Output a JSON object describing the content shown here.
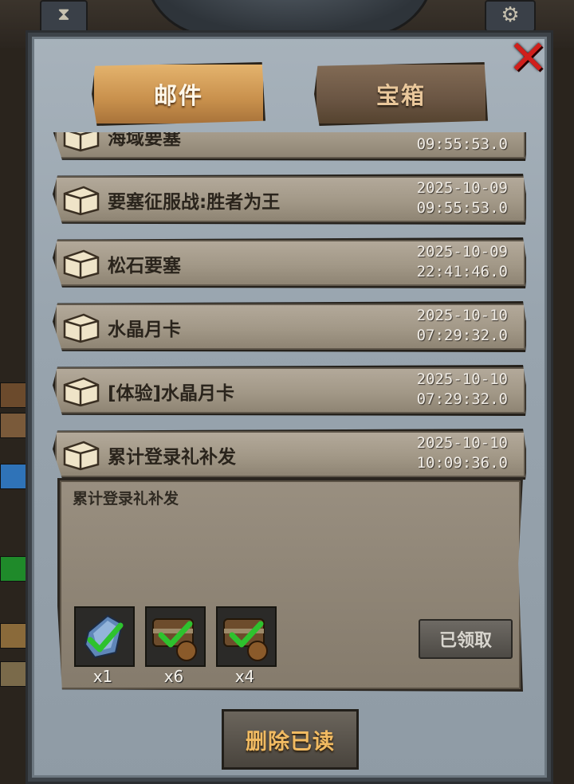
{
  "tabs": {
    "mail": "邮件",
    "chest": "宝箱"
  },
  "mails": [
    {
      "title": "海域要塞",
      "date": "",
      "time": "09:55:53.0"
    },
    {
      "title": "要塞征服战:胜者为王",
      "date": "2025-10-09",
      "time": "09:55:53.0"
    },
    {
      "title": "松石要塞",
      "date": "2025-10-09",
      "time": "22:41:46.0"
    },
    {
      "title": "水晶月卡",
      "date": "2025-10-10",
      "time": "07:29:32.0"
    },
    {
      "title": "[体验]水晶月卡",
      "date": "2025-10-10",
      "time": "07:29:32.0"
    },
    {
      "title": "累计登录礼补发",
      "date": "2025-10-10",
      "time": "10:09:36.0"
    }
  ],
  "detail": {
    "text": "累计登录礼补发",
    "rewards": [
      {
        "icon": "crystal-icon",
        "count": "x1"
      },
      {
        "icon": "chest-icon",
        "count": "x6"
      },
      {
        "icon": "chest-icon",
        "count": "x4"
      }
    ],
    "claimed_label": "已领取"
  },
  "delete_label": "删除已读",
  "colors": {
    "panel": "#98a4ae",
    "tab_active": "#c8904c",
    "tab_inactive": "#6a5543",
    "close": "#d11f1b",
    "check": "#2ec22e"
  }
}
